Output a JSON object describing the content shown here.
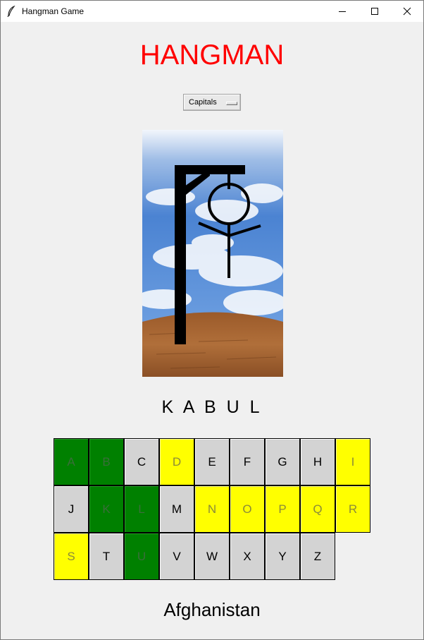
{
  "window": {
    "title": "Hangman Game"
  },
  "heading": "HANGMAN",
  "category": {
    "selected": "Capitals"
  },
  "word": "K A B U L",
  "hint": "Afghanistan",
  "colors": {
    "correct": "#008000",
    "wrong": "#ffff00",
    "unused": "#d3d3d3",
    "heading": "#ff0000"
  },
  "keyboard": {
    "keys": [
      {
        "letter": "A",
        "state": "correct"
      },
      {
        "letter": "B",
        "state": "correct"
      },
      {
        "letter": "C",
        "state": "unused"
      },
      {
        "letter": "D",
        "state": "wrong"
      },
      {
        "letter": "E",
        "state": "unused"
      },
      {
        "letter": "F",
        "state": "unused"
      },
      {
        "letter": "G",
        "state": "unused"
      },
      {
        "letter": "H",
        "state": "unused"
      },
      {
        "letter": "I",
        "state": "wrong"
      },
      {
        "letter": "J",
        "state": "unused"
      },
      {
        "letter": "K",
        "state": "correct"
      },
      {
        "letter": "L",
        "state": "correct"
      },
      {
        "letter": "M",
        "state": "unused"
      },
      {
        "letter": "N",
        "state": "wrong"
      },
      {
        "letter": "O",
        "state": "wrong"
      },
      {
        "letter": "P",
        "state": "wrong"
      },
      {
        "letter": "Q",
        "state": "wrong"
      },
      {
        "letter": "R",
        "state": "wrong"
      },
      {
        "letter": "S",
        "state": "wrong"
      },
      {
        "letter": "T",
        "state": "unused"
      },
      {
        "letter": "U",
        "state": "correct"
      },
      {
        "letter": "V",
        "state": "unused"
      },
      {
        "letter": "W",
        "state": "unused"
      },
      {
        "letter": "X",
        "state": "unused"
      },
      {
        "letter": "Y",
        "state": "unused"
      },
      {
        "letter": "Z",
        "state": "unused"
      }
    ]
  }
}
